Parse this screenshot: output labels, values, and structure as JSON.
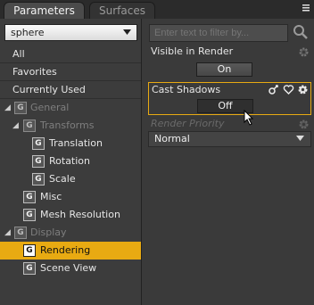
{
  "tabs": [
    {
      "label": "Parameters",
      "active": true
    },
    {
      "label": "Surfaces",
      "active": false
    }
  ],
  "left_panel": {
    "preset_select": {
      "value": "sphere"
    },
    "top_items": [
      {
        "label": "All"
      },
      {
        "label": "Favorites"
      },
      {
        "label": "Currently Used"
      }
    ],
    "tree": [
      {
        "label": "General",
        "level": 0,
        "expanded": true,
        "muted": true
      },
      {
        "label": "Transforms",
        "level": 1,
        "expanded": true,
        "muted": true
      },
      {
        "label": "Translation",
        "level": 2
      },
      {
        "label": "Rotation",
        "level": 2
      },
      {
        "label": "Scale",
        "level": 2
      },
      {
        "label": "Misc",
        "level": 1
      },
      {
        "label": "Mesh Resolution",
        "level": 1
      },
      {
        "label": "Display",
        "level": 0,
        "expanded": true,
        "muted": true
      },
      {
        "label": "Rendering",
        "level": 1,
        "selected": true
      },
      {
        "label": "Scene View",
        "level": 1
      }
    ]
  },
  "right_panel": {
    "filter": {
      "placeholder": "Enter text to filter by..."
    },
    "properties": [
      {
        "name": "Visible in Render",
        "value": "On"
      },
      {
        "name": "Cast Shadows",
        "value": "Off",
        "highlighted": true
      },
      {
        "name": "Render Priority",
        "value": "Normal",
        "disabled": true
      }
    ]
  },
  "colors": {
    "accent": "#e8aa12",
    "panel": "#3a3a3a",
    "text": "#e6e6e6",
    "muted_text": "#7e7e7e"
  },
  "icons": [
    "panel-menu-icon",
    "search-icon",
    "chevron-down-icon",
    "expand-triangle-icon",
    "group-icon",
    "link-icon",
    "favorite-heart-icon",
    "gear-icon"
  ]
}
